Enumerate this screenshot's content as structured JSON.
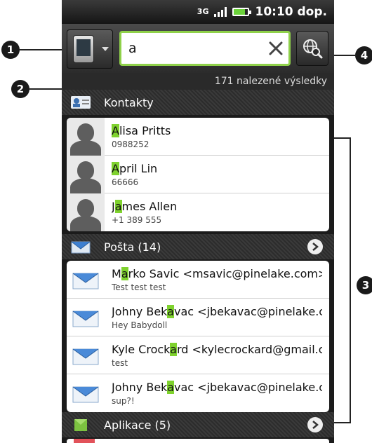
{
  "status_bar": {
    "network": "3G",
    "time": "10:10 dop."
  },
  "search": {
    "query": "a",
    "results_count": "171 nalezené výsledky"
  },
  "callouts": [
    "1",
    "2",
    "3",
    "4"
  ],
  "sections": {
    "contacts": {
      "label": "Kontakty",
      "items": [
        {
          "pre": "",
          "hl": "A",
          "post": "lisa Pritts",
          "sub": "0988252"
        },
        {
          "pre": "",
          "hl": "A",
          "post": "pril Lin",
          "sub": "66666"
        },
        {
          "pre": "J",
          "hl": "a",
          "post": "mes Allen",
          "sub": "+1 389 555"
        }
      ]
    },
    "mail": {
      "label": "Pošta (14)",
      "items": [
        {
          "pre": "M",
          "hl": "a",
          "post": "rko Savic <msavic@pinelake.com>",
          "sub": "Test test test"
        },
        {
          "pre": "Johny Bek",
          "hl": "a",
          "post": "vac <jbekavac@pinelake.com>",
          "sub": "Hey Babydoll"
        },
        {
          "pre": "Kyle Crock",
          "hl": "a",
          "post": "rd <kylecrockard@gmail.co",
          "sub": "test"
        },
        {
          "pre": "Johny Bek",
          "hl": "a",
          "post": "vac <jbekavac@pinelake.com>",
          "sub": "sup?!"
        }
      ]
    },
    "apps": {
      "label": "Aplikace (5)"
    }
  },
  "colors": {
    "highlight": "#7fd22e",
    "input_border": "#8fd14a"
  }
}
